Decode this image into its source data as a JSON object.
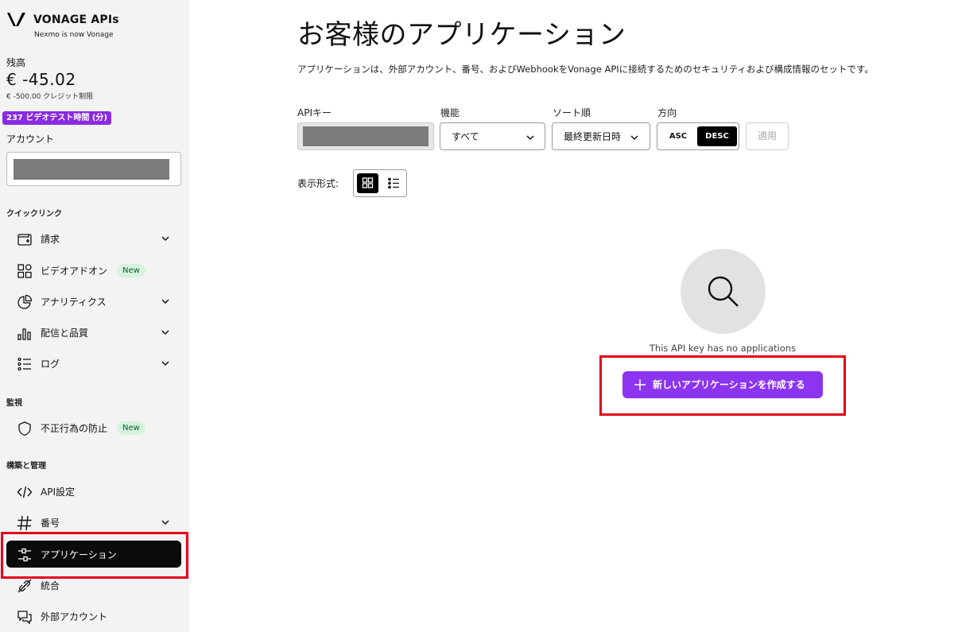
{
  "brand": {
    "name": "VONAGE APIs",
    "subtitle": "Nexmo is now Vonage"
  },
  "account": {
    "balance_label": "残高",
    "balance_amount": "€ -45.02",
    "credit_limit": "€ -500.00 クレジット制限",
    "video_badge": "237 ビデオテスト時間 (分)",
    "account_label": "アカウント"
  },
  "sidebar": {
    "sections": {
      "quick_links": "クイックリンク",
      "monitoring": "監視",
      "build_manage": "構築と管理"
    },
    "items": [
      {
        "label": "請求",
        "icon": "wallet-icon",
        "chevron": true
      },
      {
        "label": "ビデオアドオン",
        "icon": "grid-add-icon",
        "badge": "New"
      },
      {
        "label": "アナリティクス",
        "icon": "pie-chart-icon",
        "chevron": true
      },
      {
        "label": "配信と品質",
        "icon": "bar-chart-icon",
        "chevron": true
      },
      {
        "label": "ログ",
        "icon": "list-icon",
        "chevron": true
      },
      {
        "label": "不正行為の防止",
        "icon": "shield-icon",
        "badge": "New"
      },
      {
        "label": "API設定",
        "icon": "code-icon"
      },
      {
        "label": "番号",
        "icon": "hash-icon",
        "chevron": true
      },
      {
        "label": "アプリケーション",
        "icon": "sliders-icon",
        "active": true
      },
      {
        "label": "統合",
        "icon": "link-icon"
      },
      {
        "label": "外部アカウント",
        "icon": "chat-icon"
      }
    ]
  },
  "main": {
    "title": "お客様のアプリケーション",
    "description": "アプリケーションは、外部アカウント、番号、およびWebhookをVonage APIに接続するためのセキュリティおよび構成情報のセットです。",
    "filters": {
      "api_key_label": "APIキー",
      "feature_label": "機能",
      "feature_value": "すべて",
      "sort_label": "ソート順",
      "sort_value": "最終更新日時",
      "direction_label": "方向",
      "asc": "ASC",
      "desc": "DESC",
      "apply": "適用"
    },
    "view_label": "表示形式:",
    "empty_text": "This API key has no applications",
    "create_button": "新しいアプリケーションを作成する"
  },
  "colors": {
    "accent": "#8c35f0",
    "highlight": "#e3001b",
    "active_nav": "#0b0b0b",
    "new_badge": "#d6f3de"
  }
}
